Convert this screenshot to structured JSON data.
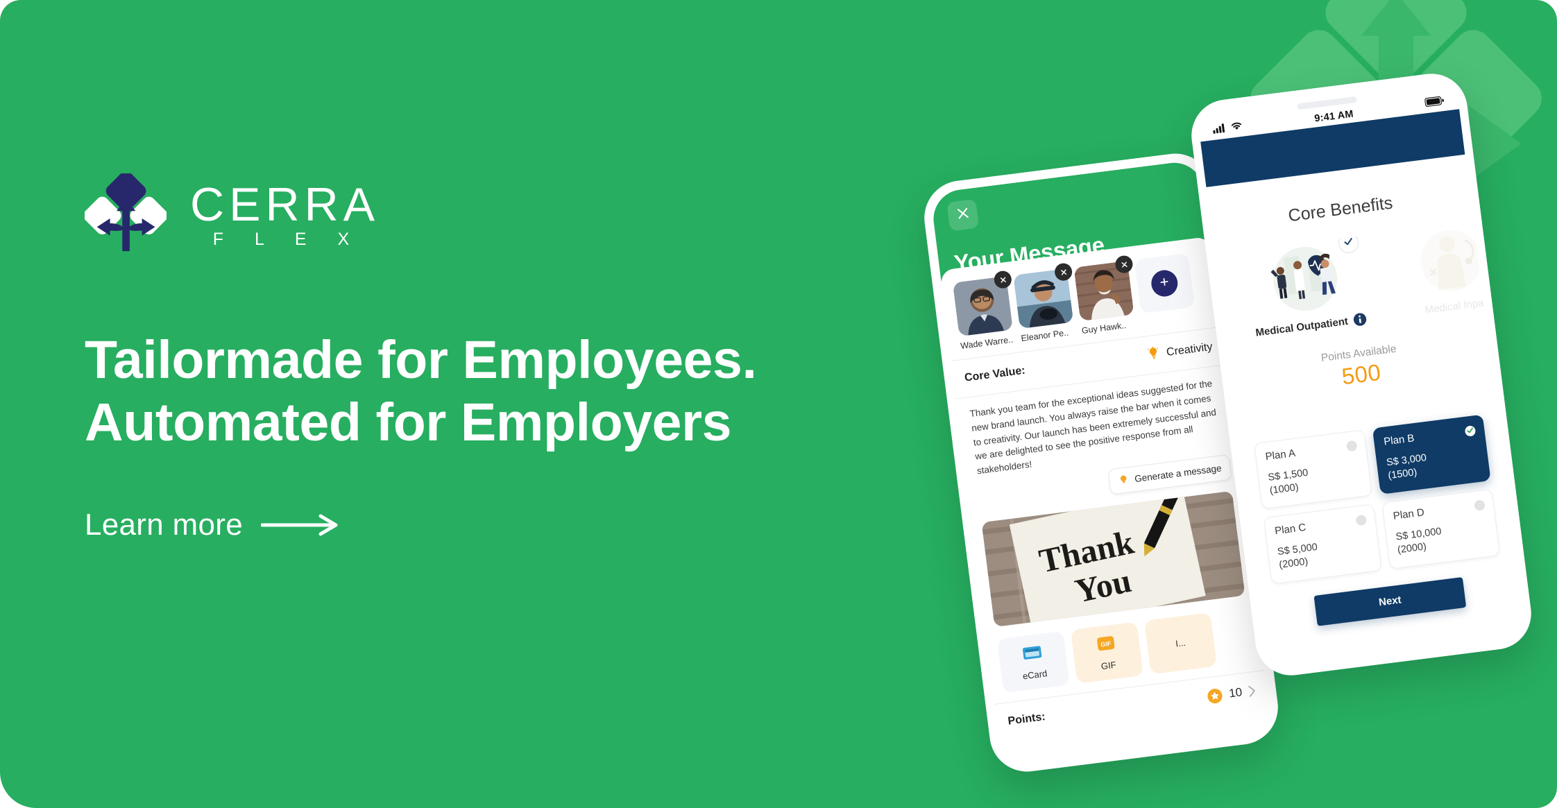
{
  "brand": {
    "logo_icon": "cerra-diamond-arrows-logo",
    "name": "CERRA",
    "sub": "F L E X",
    "green": "#27AE60",
    "navy": "#0F3B66",
    "logo_navy": "#27286B",
    "orange": "#F39C12"
  },
  "hero": {
    "headline": "Tailormade for Employees. Automated for Employers",
    "cta_label": "Learn more",
    "cta_icon": "long-arrow-right-icon",
    "watermark_icon": "cerra-logo-watermark"
  },
  "message_phone": {
    "close_icon": "close-icon",
    "title": "Your Message",
    "recipients": [
      {
        "name": "Wade Warre..",
        "remove_icon": "remove-recipient-icon",
        "avatar": "avatar-wade"
      },
      {
        "name": "Eleanor Pe..",
        "remove_icon": "remove-recipient-icon",
        "avatar": "avatar-eleanor"
      },
      {
        "name": "Guy Hawk..",
        "remove_icon": "remove-recipient-icon",
        "avatar": "avatar-guy"
      }
    ],
    "add_recipient_icon": "plus-icon",
    "core_value_label": "Core Value:",
    "core_value_selected": "Creativity",
    "core_value_icon": "lightbulb-icon",
    "message_text": "Thank you team for the exceptional ideas suggested for the new brand launch. You always raise the bar when it comes to creativity. Our launch has been extremely successful and we are delighted to see the positive response from all stakeholders!",
    "generate_label": "Generate a message",
    "generate_icon": "lightbulb-icon",
    "card_image_text_line1": "Thank",
    "card_image_text_line2": "You",
    "attachments": [
      {
        "label": "eCard",
        "icon": "ecard-icon",
        "active": false
      },
      {
        "label": "GIF",
        "icon": "gif-icon",
        "active": true
      },
      {
        "label": "I...",
        "icon": "image-icon",
        "active": true
      }
    ],
    "points_label": "Points:",
    "points_value": "10",
    "points_icon": "star-badge-icon",
    "points_chevron_icon": "chevron-right-icon"
  },
  "benefits_phone": {
    "status": {
      "signal_icon": "cellular-signal-icon",
      "wifi_icon": "wifi-icon",
      "time": "9:41 AM",
      "battery_icon": "battery-icon"
    },
    "title": "Core Benefits",
    "benefits": [
      {
        "caption": "Medical Outpatient",
        "info_icon": "info-icon",
        "selected": true,
        "check_icon": "check-icon",
        "art": "doctors-illustration"
      },
      {
        "caption": "Medical Inpati",
        "info_icon": "info-icon",
        "selected": false,
        "art": "patient-illustration"
      }
    ],
    "points_available_label": "Points Available",
    "points_available_value": "500",
    "plans": [
      {
        "name": "Plan A",
        "price": "S$ 1,500\n(1000)",
        "selected": false
      },
      {
        "name": "Plan B",
        "price": "S$ 3,000\n(1500)",
        "selected": true,
        "check_icon": "check-icon"
      },
      {
        "name": "Plan C",
        "price": "S$ 5,000\n(2000)",
        "selected": false
      },
      {
        "name": "Plan D",
        "price": "S$ 10,000\n(2000)",
        "selected": false
      }
    ],
    "next_label": "Next"
  }
}
